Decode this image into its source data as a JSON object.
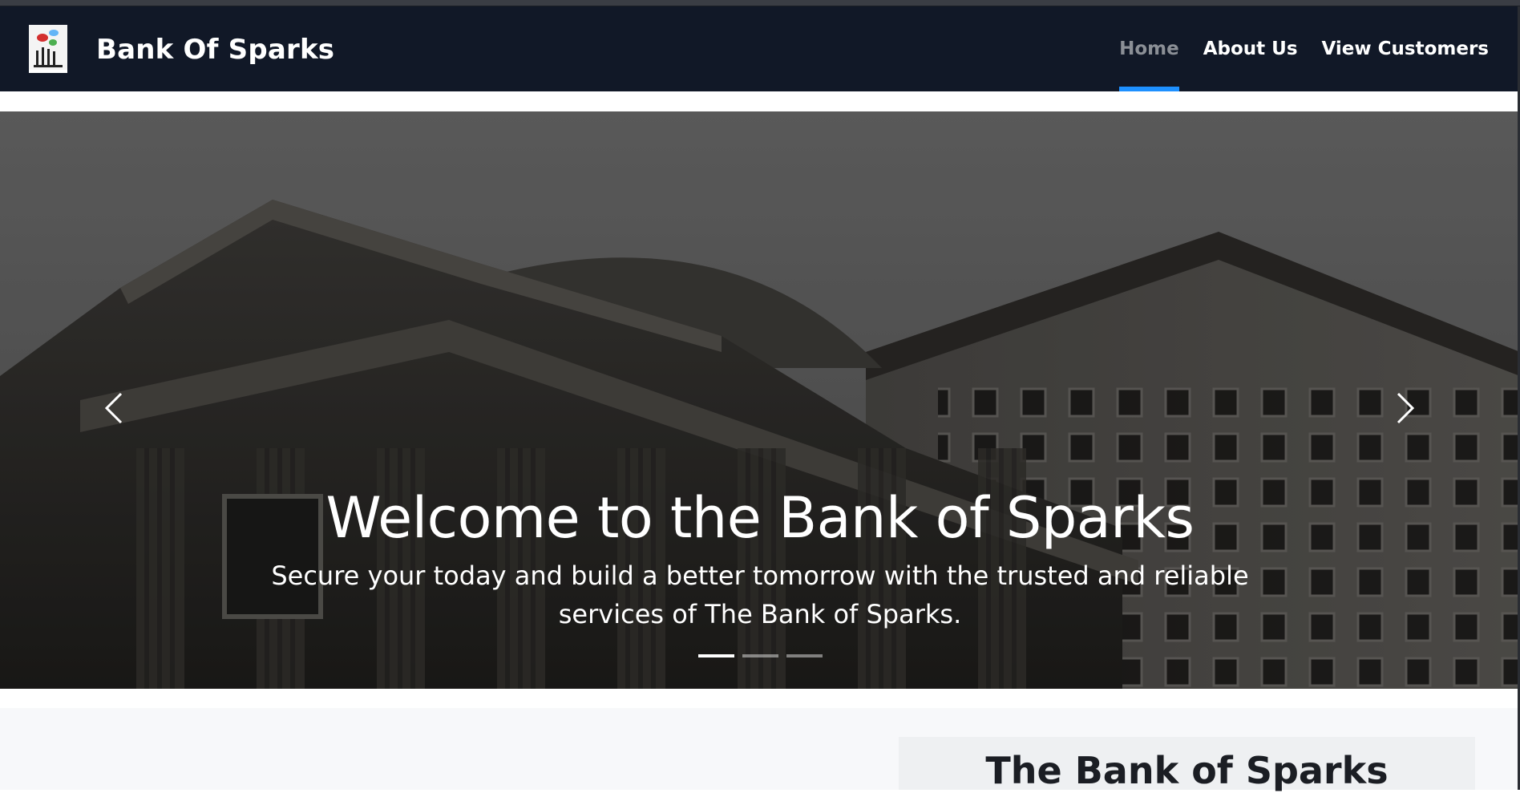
{
  "navbar": {
    "brand_name": "Bank Of Sparks",
    "brand_logo_icon": "hands-speech-bubbles-icon",
    "links": [
      {
        "label": "Home",
        "active": true
      },
      {
        "label": "About Us",
        "active": false
      },
      {
        "label": "View Customers",
        "active": false
      }
    ],
    "active_color": "#1e90ff",
    "background": "#111827"
  },
  "hero": {
    "title": "Welcome to the Bank of Sparks",
    "subtitle": "Secure your today and build a better tomorrow with the trusted and reliable services of The Bank of Sparks.",
    "prev_icon": "chevron-left-icon",
    "next_icon": "chevron-right-icon",
    "slide_count": 3,
    "active_slide": 1
  },
  "about": {
    "title": "The Bank of Sparks"
  }
}
